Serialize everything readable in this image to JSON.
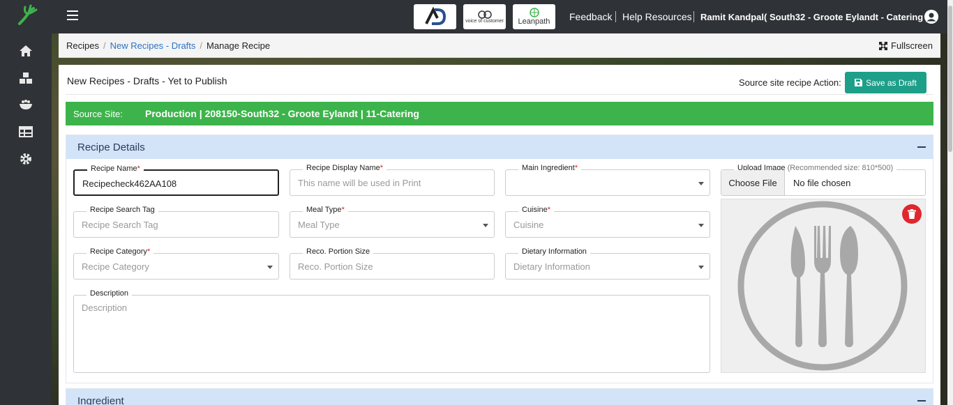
{
  "topbar": {
    "badges": [
      "AD",
      "voice of customer",
      "Leanpath"
    ],
    "feedback": "Feedback",
    "help": "Help Resources",
    "user": "Ramit Kandpal( South32 - Groote Eylandt - Catering )"
  },
  "breadcrumb": {
    "items": [
      "Recipes",
      "New Recipes - Drafts",
      "Manage Recipe"
    ],
    "fullscreen": "Fullscreen"
  },
  "card": {
    "title": "New Recipes - Drafts - Yet to Publish",
    "source_action_label": "Source site recipe Action:",
    "save_label": "Save as Draft"
  },
  "source_site": {
    "label": "Source Site:",
    "value": "Production | 208150-South32 - Groote Eylandt | 11-Catering"
  },
  "recipe_details": {
    "title": "Recipe Details",
    "recipe_name": {
      "label": "Recipe Name",
      "value": "Recipecheck462AA108"
    },
    "display_name": {
      "label": "Recipe Display Name",
      "placeholder": "This name will be used in Print"
    },
    "main_ingredient": {
      "label": "Main Ingredient"
    },
    "search_tag": {
      "label": "Recipe Search Tag",
      "placeholder": "Recipe Search Tag"
    },
    "meal_type": {
      "label": "Meal Type",
      "placeholder": "Meal Type"
    },
    "cuisine": {
      "label": "Cuisine",
      "placeholder": "Cuisine"
    },
    "category": {
      "label": "Recipe Category",
      "placeholder": "Recipe Category"
    },
    "portion": {
      "label": "Reco. Portion Size",
      "placeholder": "Reco. Portion Size"
    },
    "dietary": {
      "label": "Dietary Information",
      "placeholder": "Dietary Information"
    },
    "description": {
      "label": "Description",
      "placeholder": "Description"
    },
    "upload": {
      "label": "Upload Image",
      "hint": "(Recommended size: 810*500)",
      "choose": "Choose File",
      "status": "No file chosen"
    }
  },
  "ingredient": {
    "title": "Ingredient"
  },
  "required_mark": "*",
  "colors": {
    "accent": "#1e9f8a",
    "source_bar": "#3cb44b",
    "section_head": "#d3e3f8",
    "delete": "#e0262e"
  }
}
